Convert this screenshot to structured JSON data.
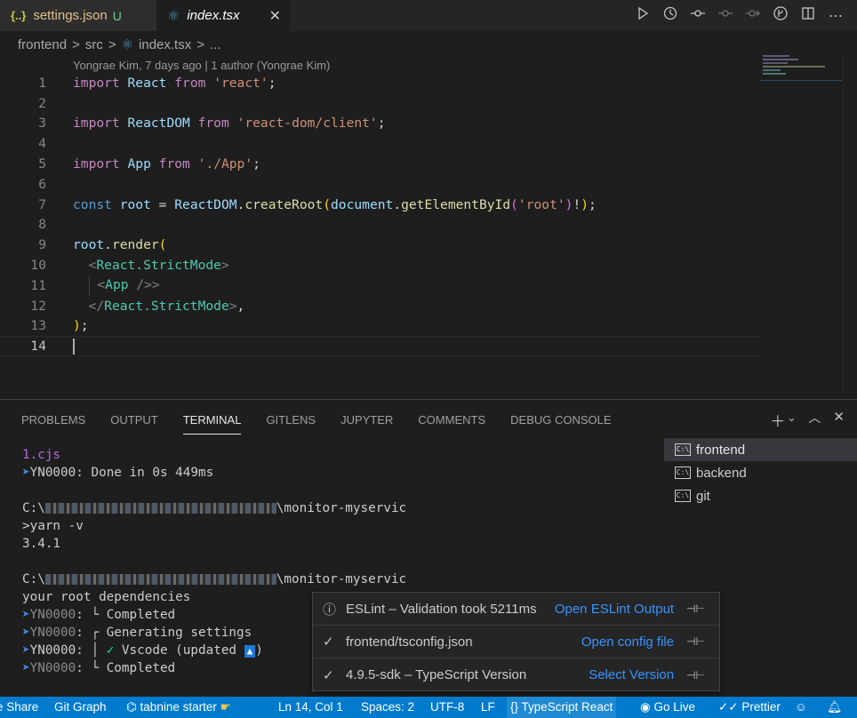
{
  "tabs": [
    {
      "icon": "{..}",
      "label": "settings.json",
      "badge": "U",
      "active": false
    },
    {
      "icon": "⚛",
      "label": "index.tsx",
      "close": "✕",
      "active": true
    }
  ],
  "breadcrumb": {
    "items": [
      "frontend",
      "src",
      "index.tsx",
      "..."
    ],
    "separator": ">"
  },
  "blame": "Yongrae Kim, 7 days ago | 1 author (Yongrae Kim)",
  "editor": {
    "line_numbers": [
      "1",
      "2",
      "3",
      "4",
      "5",
      "6",
      "7",
      "8",
      "9",
      "10",
      "11",
      "12",
      "13",
      "14"
    ],
    "current_line": "14",
    "tokens": {
      "import": "import",
      "from": "from",
      "const": "const",
      "React": "React",
      "react_str": "'react'",
      "ReactDOM": "ReactDOM",
      "react_dom_str": "'react-dom/client'",
      "App": "App",
      "app_str": "'./App'",
      "root": "root",
      "eq": " = ",
      "dot": ".",
      "createRoot": "createRoot",
      "document": "document",
      "getElementById": "getElementById",
      "root_str": "'root'",
      "bang": "!",
      "semicolon": ";",
      "render": "render",
      "open_paren": "(",
      "close_paren": ")",
      "close_paren_semi": ");",
      "open_angle": "<",
      "close_open_angle": "</",
      "close_angle": ">",
      "StrictMode": "React.StrictMode",
      "self_close": " />",
      "comma": ","
    }
  },
  "panel": {
    "tabs": [
      "PROBLEMS",
      "OUTPUT",
      "TERMINAL",
      "GITLENS",
      "JUPYTER",
      "COMMENTS",
      "DEBUG CONSOLE"
    ],
    "active_tab": "TERMINAL",
    "terminal_lines": {
      "l1": "1.cjs",
      "l2_code": "YN0000",
      "l2_text": ": Done in 0s 449ms",
      "l4_prefix": "C:\\",
      "l4_suffix": "\\monitor-myservic",
      "l5": ">yarn -v",
      "l6": "3.4.1",
      "l8_prefix": "C:\\",
      "l8_suffix": "\\monitor-myservic",
      "l9": "your root dependencies",
      "l10_code": "YN0000",
      "l10_text": ": └ Completed",
      "l11_code": "YN0000",
      "l11_text": ": ┌ Generating settings",
      "l12_code": "YN0000",
      "l12_mid": ": │ ",
      "l12_check": "✓",
      "l12_text": " Vscode (updated ",
      "l12_badge": "▲",
      "l12_end": ")",
      "l13_code": "YN0000",
      "l13_text": ": └ Completed"
    },
    "terminals": [
      "frontend",
      "backend",
      "git"
    ]
  },
  "popup": [
    {
      "icon": "ⓘ",
      "text": "ESLint – Validation took 5211ms",
      "link": "Open ESLint Output"
    },
    {
      "icon": "✓",
      "text": "frontend/tsconfig.json",
      "link": "Open config file"
    },
    {
      "icon": "✓",
      "text": "4.9.5-sdk – TypeScript Version",
      "link": "Select Version"
    }
  ],
  "statusbar": {
    "share": "e Share",
    "git_graph": "Git Graph",
    "tabnine": "tabnine starter",
    "position": "Ln 14, Col 1",
    "spaces": "Spaces: 2",
    "encoding": "UTF-8",
    "eol": "LF",
    "language": "TypeScript React",
    "golive": "Go Live",
    "prettier": "Prettier"
  }
}
